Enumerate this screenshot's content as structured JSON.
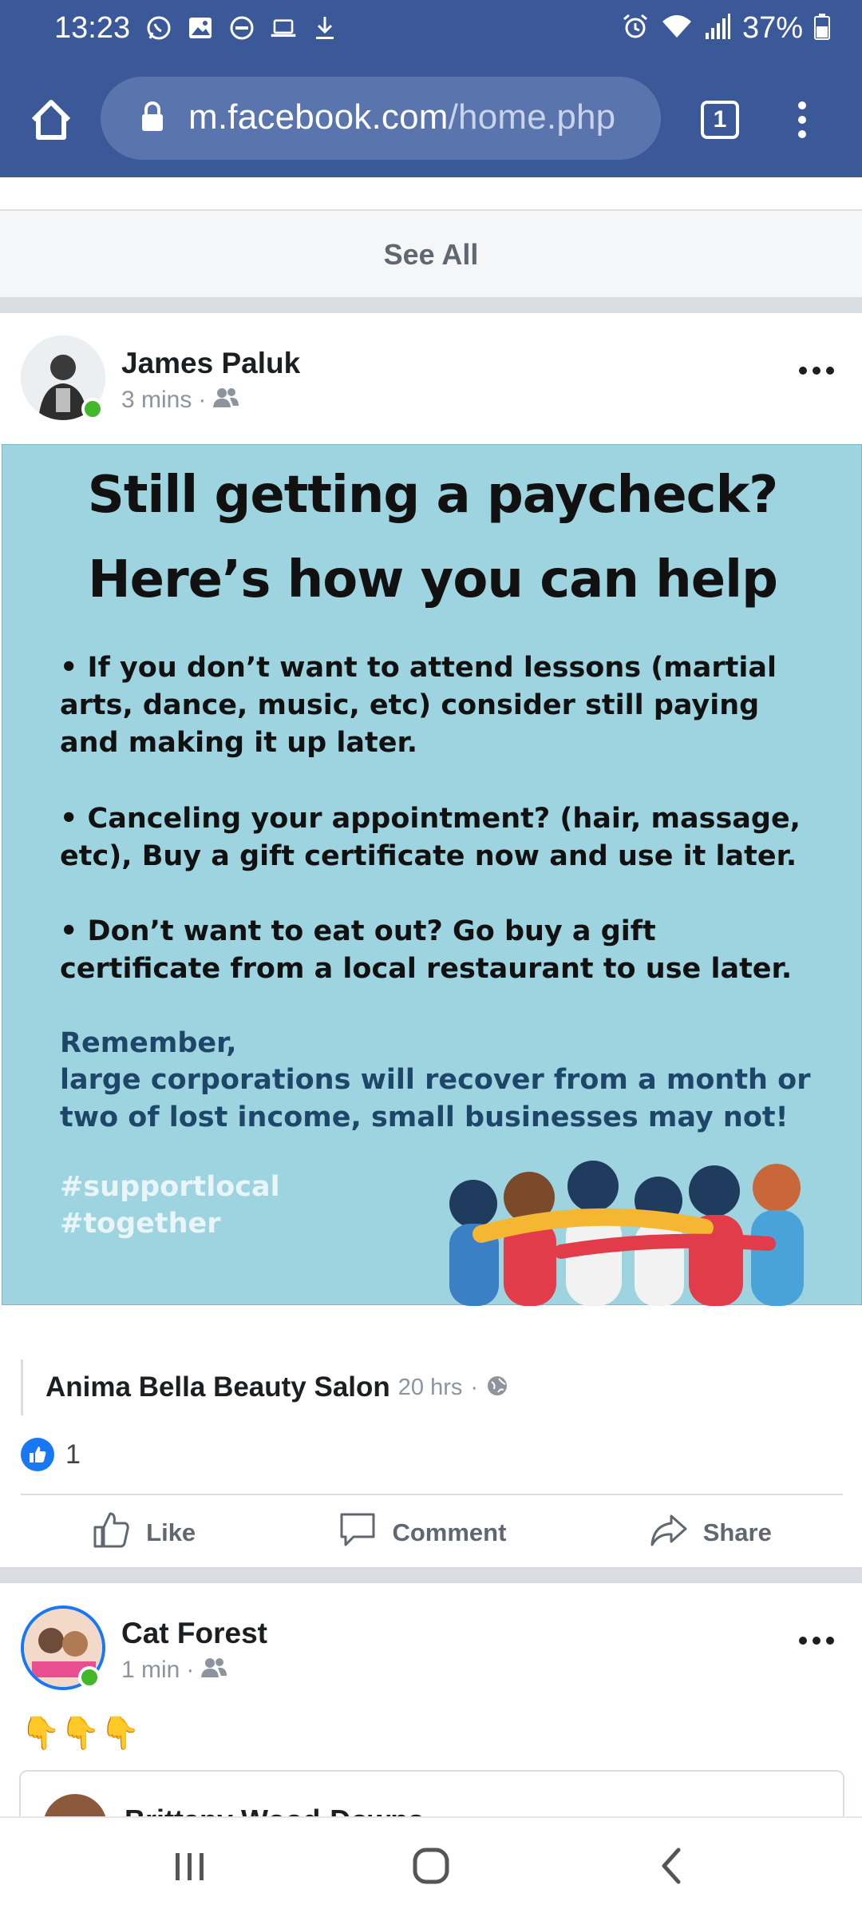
{
  "status_bar": {
    "time": "13:23",
    "battery": "37%"
  },
  "browser": {
    "url_domain": "m.facebook.com",
    "url_path": "/home.php",
    "tab_count": "1"
  },
  "feed": {
    "see_all_label": "See All"
  },
  "post1": {
    "author": "James Paluk",
    "time": "3 mins",
    "separator": "·",
    "promo": {
      "title_line1": "Still getting a paycheck?",
      "title_line2": "Here’s how you can help",
      "bullets": [
        "• If you don’t want to attend lessons (martial arts, dance, music, etc) consider still paying and making it up later.",
        "• Canceling your appointment? (hair, massage, etc), Buy a gift certificate now and use it later.",
        "• Don’t want to eat out? Go buy a gift certificate from a local restaurant to use later."
      ],
      "remember_line1": "Remember,",
      "remember_line2": "large corporations will recover from a month or two of lost income, small businesses may not!",
      "tag1": "#supportlocal",
      "tag2": "#together"
    },
    "shared_from": {
      "name": "Anima Bella Beauty Salon",
      "time": "20 hrs",
      "separator": "·"
    },
    "like_count": "1",
    "actions": {
      "like": "Like",
      "comment": "Comment",
      "share": "Share"
    }
  },
  "post2": {
    "author": "Cat Forest",
    "time": "1 min",
    "separator": "·",
    "text": "👇👇👇",
    "shared_card_name": "Brittany Wood-Downs"
  },
  "colors": {
    "brand": "#3b5998",
    "like_blue": "#1877f2",
    "promo_bg": "#9dd4e0",
    "online": "#42b72a"
  }
}
